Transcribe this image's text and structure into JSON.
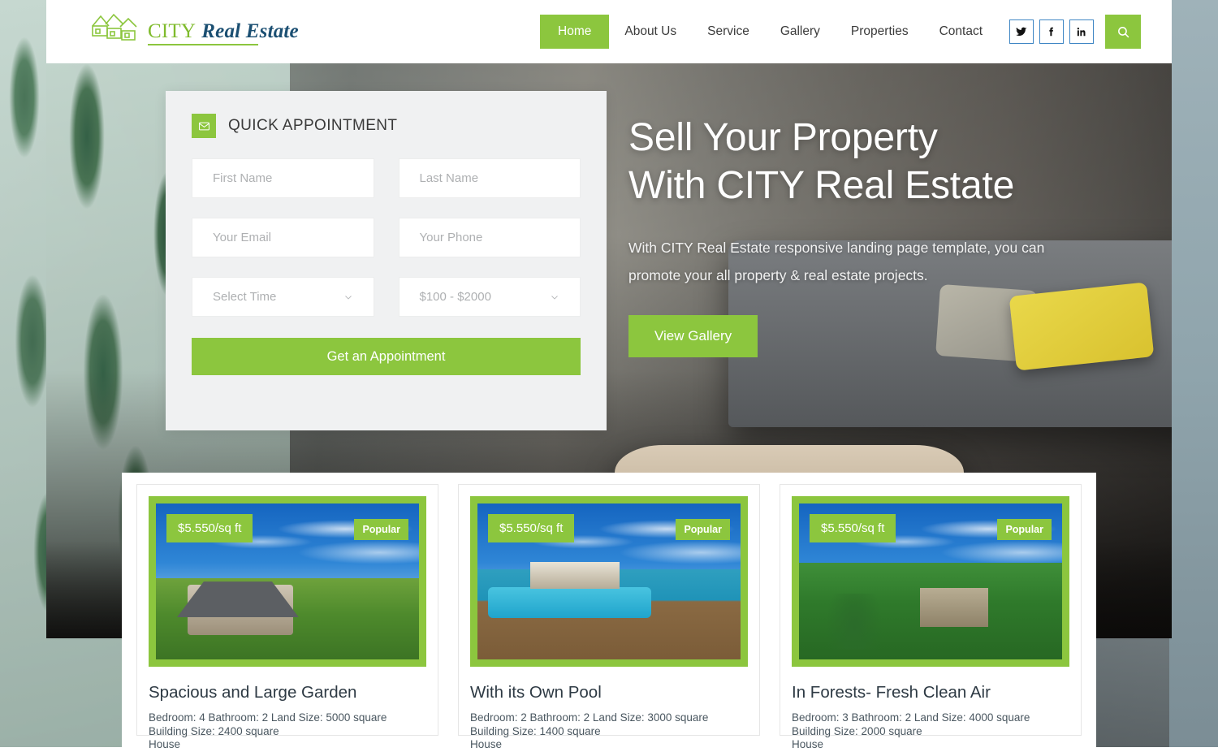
{
  "site": {
    "logo_city": "CITY",
    "logo_realestate": "Real Estate"
  },
  "nav": {
    "items": [
      {
        "label": "Home",
        "active": true
      },
      {
        "label": "About Us",
        "active": false
      },
      {
        "label": "Service",
        "active": false
      },
      {
        "label": "Gallery",
        "active": false
      },
      {
        "label": "Properties",
        "active": false
      },
      {
        "label": "Contact",
        "active": false
      }
    ],
    "social": [
      {
        "name": "twitter-icon",
        "label": "Twitter"
      },
      {
        "name": "facebook-icon",
        "label": "Facebook"
      },
      {
        "name": "linkedin-icon",
        "label": "LinkedIn"
      }
    ],
    "search_icon": "search-icon",
    "accent_color": "#8cc63e",
    "social_border_color": "#3f86c4"
  },
  "appointment": {
    "icon": "envelope-icon",
    "title": "QUICK APPOINTMENT",
    "fields": {
      "first_name_placeholder": "First Name",
      "last_name_placeholder": "Last Name",
      "email_placeholder": "Your Email",
      "phone_placeholder": "Your Phone",
      "time_selected": "Select Time",
      "price_selected": "$100 - $2000"
    },
    "submit_label": "Get an Appointment"
  },
  "hero": {
    "heading_line1": "Sell Your Property",
    "heading_line2": "With CITY Real Estate",
    "paragraph": "With CITY Real Estate responsive landing page template, you can promote your all property & real estate projects.",
    "cta_label": "View Gallery"
  },
  "properties": [
    {
      "price": "$5.550/sq ft",
      "badge": "Popular",
      "title": "Spacious and Large Garden",
      "meta_line1": "Bedroom: 4 Bathroom: 2 Land Size: 5000 square",
      "meta_line2": "Building Size: 2400 square",
      "meta_line3": "House"
    },
    {
      "price": "$5.550/sq ft",
      "badge": "Popular",
      "title": "With its Own Pool",
      "meta_line1": "Bedroom: 2 Bathroom: 2 Land Size: 3000 square",
      "meta_line2": "Building Size: 1400 square",
      "meta_line3": "House"
    },
    {
      "price": "$5.550/sq ft",
      "badge": "Popular",
      "title": "In Forests- Fresh Clean Air",
      "meta_line1": "Bedroom: 3 Bathroom: 2 Land Size: 4000 square",
      "meta_line2": "Building Size: 2000 square",
      "meta_line3": "House"
    }
  ]
}
